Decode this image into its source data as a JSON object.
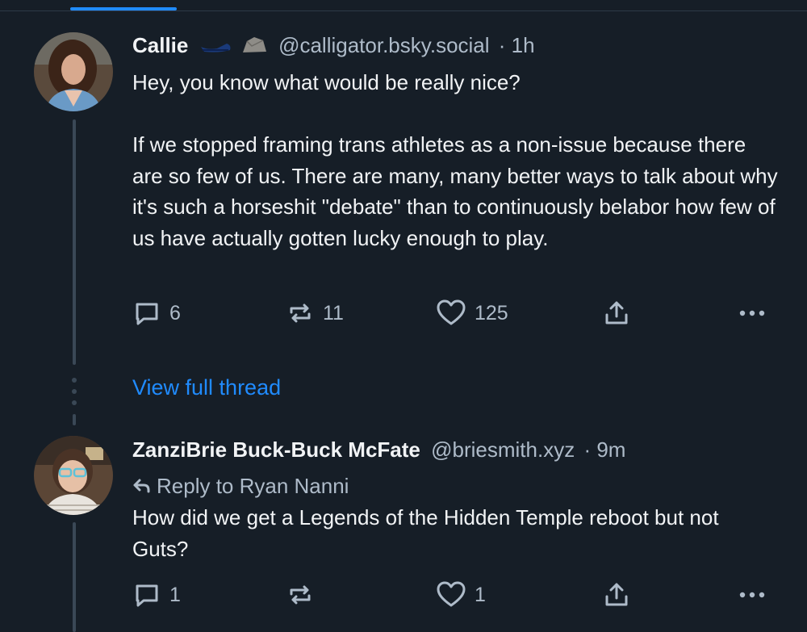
{
  "post1": {
    "name": "Callie",
    "handle": "@calligator.bsky.social",
    "time": "· 1h",
    "body": "Hey, you know what would be really nice?\n\nIf we stopped framing trans athletes as a non-issue because there are so few of us. There are many, many better ways to talk about why it's such a horseshit \"debate\" than to continuously belabor how few of us have actually gotten lucky enough to play.",
    "replies": "6",
    "reposts": "11",
    "likes": "125"
  },
  "thread_link": "View full thread",
  "post2": {
    "name": "ZanziBrie Buck-Buck McFate",
    "handle": "@briesmith.xyz",
    "time": "· 9m",
    "reply_to": "Reply to Ryan Nanni",
    "body": "How did we get a Legends of the Hidden Temple reboot but not Guts?",
    "replies": "1",
    "reposts": "",
    "likes": "1"
  },
  "colors": {
    "background": "#161e27",
    "accent": "#208bfe",
    "muted": "#aebbc9"
  },
  "icons": [
    "reply-icon",
    "repost-icon",
    "like-icon",
    "share-icon",
    "more-icon",
    "arrow-reply-icon",
    "shoe-emoji",
    "rock-emoji"
  ]
}
